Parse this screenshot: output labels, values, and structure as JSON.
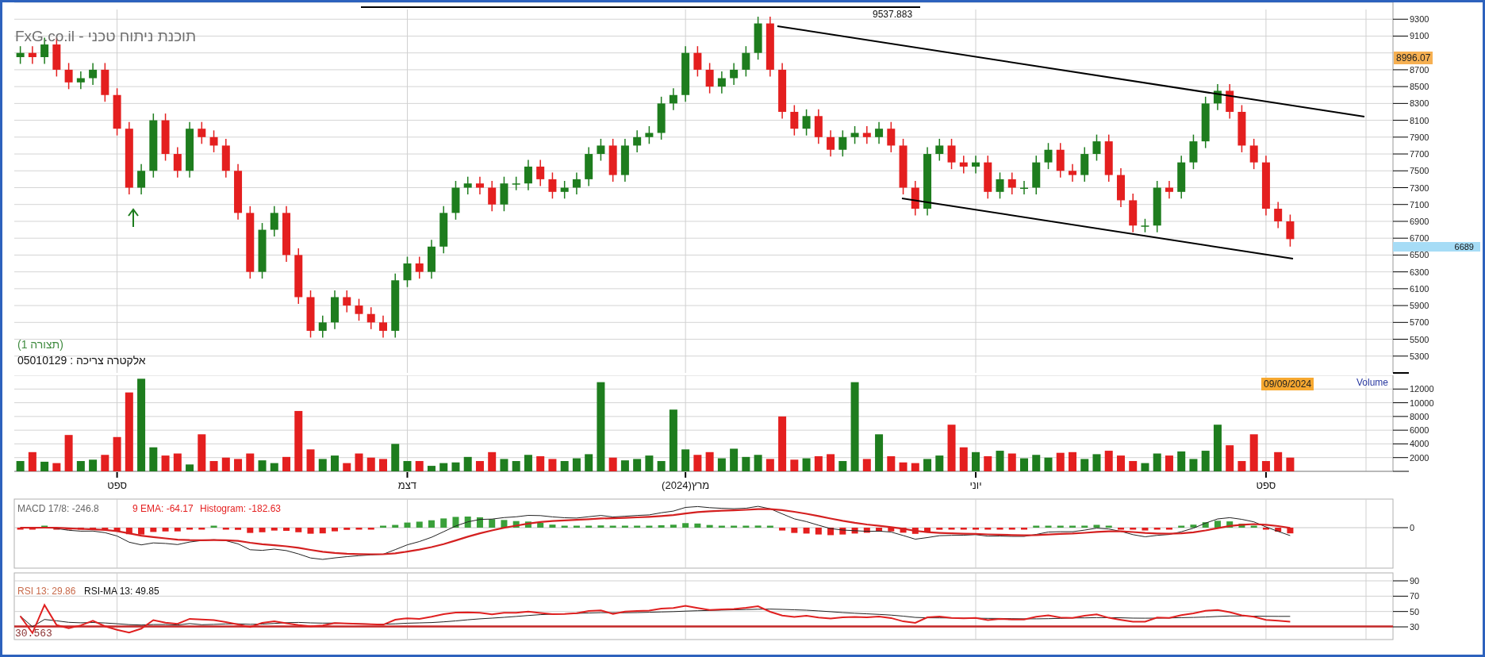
{
  "title": "FxG.co.il - תוכנת ניתוח טכני",
  "price_panel": {
    "layout_label": "(תצורה 1)",
    "instrument_label": "אלקטרה צריכה : 05010129",
    "high_label": "9537.883",
    "cursor_price": "8996.07",
    "last_price": "6689",
    "chart_data": {
      "type": "candlestick",
      "grid": true,
      "ylim": [
        5100,
        9500
      ],
      "yticks": [
        5300,
        5500,
        5700,
        5900,
        6100,
        6300,
        6500,
        6700,
        6900,
        7100,
        7300,
        7500,
        7700,
        7900,
        8100,
        8300,
        8500,
        8700,
        9100,
        9300
      ],
      "categories": [
        null,
        null,
        null,
        null,
        null,
        null,
        null,
        null,
        null,
        null,
        null,
        null,
        null,
        null,
        null,
        null,
        null,
        null,
        null,
        null,
        null,
        null,
        null,
        null,
        null,
        null,
        null,
        null,
        null,
        null,
        null,
        null,
        null,
        null,
        null,
        null,
        null,
        null,
        null,
        null,
        null,
        null,
        null,
        null,
        null,
        null,
        null,
        null,
        null,
        null,
        null,
        null,
        null,
        null,
        null,
        null,
        null,
        null,
        null,
        null,
        null,
        null,
        null,
        null,
        null,
        null,
        null,
        null,
        null,
        null,
        null,
        null,
        null,
        null,
        null,
        null,
        null,
        null,
        null,
        null,
        null,
        null,
        null,
        null,
        null,
        null,
        null,
        null,
        null,
        null,
        null,
        null,
        null,
        null,
        null,
        null,
        null,
        null,
        null,
        null,
        null,
        null,
        null,
        null,
        null,
        null,
        null,
        null,
        null,
        null,
        null,
        null,
        null,
        null
      ],
      "ohlc": [
        [
          8850,
          8980,
          8770,
          8900
        ],
        [
          8900,
          8980,
          8770,
          8850
        ],
        [
          8850,
          9080,
          8770,
          9000
        ],
        [
          9000,
          9080,
          8620,
          8700
        ],
        [
          8700,
          8780,
          8470,
          8550
        ],
        [
          8550,
          8680,
          8470,
          8600
        ],
        [
          8600,
          8780,
          8520,
          8700
        ],
        [
          8700,
          8780,
          8320,
          8400
        ],
        [
          8400,
          8480,
          7920,
          8000
        ],
        [
          8000,
          8080,
          7220,
          7300
        ],
        [
          7300,
          7580,
          7220,
          7500
        ],
        [
          7500,
          8180,
          7420,
          8100
        ],
        [
          8100,
          8180,
          7620,
          7700
        ],
        [
          7700,
          7780,
          7420,
          7500
        ],
        [
          7500,
          8080,
          7420,
          8000
        ],
        [
          8000,
          8080,
          7820,
          7900
        ],
        [
          7900,
          7980,
          7720,
          7800
        ],
        [
          7800,
          7880,
          7420,
          7500
        ],
        [
          7500,
          7580,
          6920,
          7000
        ],
        [
          7000,
          7080,
          6220,
          6300
        ],
        [
          6300,
          6880,
          6220,
          6800
        ],
        [
          6800,
          7080,
          6720,
          7000
        ],
        [
          7000,
          7080,
          6420,
          6500
        ],
        [
          6500,
          6580,
          5920,
          6000
        ],
        [
          6000,
          6080,
          5520,
          5600
        ],
        [
          5600,
          5780,
          5520,
          5700
        ],
        [
          5700,
          6080,
          5620,
          6000
        ],
        [
          6000,
          6080,
          5820,
          5900
        ],
        [
          5900,
          5980,
          5720,
          5800
        ],
        [
          5800,
          5880,
          5620,
          5700
        ],
        [
          5700,
          5780,
          5520,
          5600
        ],
        [
          5600,
          6280,
          5520,
          6200
        ],
        [
          6200,
          6480,
          6120,
          6400
        ],
        [
          6400,
          6480,
          6220,
          6300
        ],
        [
          6300,
          6680,
          6220,
          6600
        ],
        [
          6600,
          7080,
          6520,
          7000
        ],
        [
          7000,
          7380,
          6920,
          7300
        ],
        [
          7300,
          7430,
          7220,
          7350
        ],
        [
          7350,
          7430,
          7220,
          7300
        ],
        [
          7300,
          7380,
          7020,
          7100
        ],
        [
          7100,
          7430,
          7020,
          7350
        ],
        [
          7350,
          7430,
          7270,
          7350
        ],
        [
          7350,
          7630,
          7270,
          7550
        ],
        [
          7550,
          7630,
          7320,
          7400
        ],
        [
          7400,
          7480,
          7170,
          7250
        ],
        [
          7250,
          7380,
          7170,
          7300
        ],
        [
          7300,
          7480,
          7220,
          7400
        ],
        [
          7400,
          7780,
          7320,
          7700
        ],
        [
          7700,
          7880,
          7620,
          7800
        ],
        [
          7800,
          7880,
          7370,
          7450
        ],
        [
          7450,
          7880,
          7370,
          7800
        ],
        [
          7800,
          7980,
          7720,
          7900
        ],
        [
          7900,
          8030,
          7820,
          7950
        ],
        [
          7950,
          8380,
          7870,
          8300
        ],
        [
          8300,
          8480,
          8220,
          8400
        ],
        [
          8400,
          8980,
          8320,
          8900
        ],
        [
          8900,
          8980,
          8620,
          8700
        ],
        [
          8700,
          8780,
          8420,
          8500
        ],
        [
          8500,
          8680,
          8420,
          8600
        ],
        [
          8600,
          8780,
          8520,
          8700
        ],
        [
          8700,
          8980,
          8620,
          8900
        ],
        [
          8900,
          9330,
          8820,
          9250
        ],
        [
          9250,
          9330,
          8620,
          8700
        ],
        [
          8700,
          8780,
          8120,
          8200
        ],
        [
          8200,
          8280,
          7920,
          8000
        ],
        [
          8000,
          8230,
          7920,
          8150
        ],
        [
          8150,
          8230,
          7820,
          7900
        ],
        [
          7900,
          7980,
          7670,
          7750
        ],
        [
          7750,
          7980,
          7670,
          7900
        ],
        [
          7900,
          8030,
          7820,
          7950
        ],
        [
          7950,
          8030,
          7820,
          7900
        ],
        [
          7900,
          8080,
          7820,
          8000
        ],
        [
          8000,
          8080,
          7720,
          7800
        ],
        [
          7800,
          7880,
          7220,
          7300
        ],
        [
          7300,
          7380,
          6970,
          7050
        ],
        [
          7050,
          7780,
          6970,
          7700
        ],
        [
          7700,
          7880,
          7620,
          7800
        ],
        [
          7800,
          7880,
          7520,
          7600
        ],
        [
          7600,
          7680,
          7470,
          7550
        ],
        [
          7550,
          7680,
          7470,
          7600
        ],
        [
          7600,
          7680,
          7170,
          7250
        ],
        [
          7250,
          7480,
          7170,
          7400
        ],
        [
          7400,
          7480,
          7220,
          7300
        ],
        [
          7300,
          7380,
          7220,
          7300
        ],
        [
          7300,
          7680,
          7220,
          7600
        ],
        [
          7600,
          7830,
          7520,
          7750
        ],
        [
          7750,
          7830,
          7420,
          7500
        ],
        [
          7500,
          7580,
          7370,
          7450
        ],
        [
          7450,
          7780,
          7370,
          7700
        ],
        [
          7700,
          7930,
          7620,
          7850
        ],
        [
          7850,
          7930,
          7370,
          7450
        ],
        [
          7450,
          7530,
          7070,
          7150
        ],
        [
          7150,
          7230,
          6770,
          6850
        ],
        [
          6850,
          6930,
          6770,
          6850
        ],
        [
          6850,
          7380,
          6770,
          7300
        ],
        [
          7300,
          7380,
          7170,
          7250
        ],
        [
          7250,
          7680,
          7170,
          7600
        ],
        [
          7600,
          7930,
          7520,
          7850
        ],
        [
          7850,
          8380,
          7770,
          8300
        ],
        [
          8300,
          8530,
          8220,
          8450
        ],
        [
          8450,
          8530,
          8120,
          8200
        ],
        [
          8200,
          8280,
          7720,
          7800
        ],
        [
          7800,
          7880,
          7520,
          7600
        ],
        [
          7600,
          7680,
          6970,
          7050
        ],
        [
          7050,
          7130,
          6820,
          6900
        ],
        [
          6900,
          6980,
          6600,
          6689
        ],
        null,
        null,
        null,
        null,
        null,
        null,
        null,
        null
      ]
    }
  },
  "volume_panel": {
    "date_badge": "09/09/2024",
    "label": "Volume",
    "chart_data": {
      "type": "bar",
      "grid": true,
      "ylim": [
        0,
        14000
      ],
      "yticks": [
        2000,
        4000,
        6000,
        8000,
        10000,
        12000
      ],
      "categories": [
        null,
        null,
        null,
        null,
        null,
        null,
        null,
        null,
        "ספט",
        null,
        null,
        null,
        null,
        null,
        null,
        null,
        null,
        null,
        null,
        null,
        null,
        null,
        null,
        null,
        null,
        null,
        null,
        null,
        null,
        null,
        null,
        null,
        "דצמ",
        null,
        null,
        null,
        null,
        null,
        null,
        null,
        null,
        null,
        null,
        null,
        null,
        null,
        null,
        null,
        null,
        null,
        null,
        null,
        null,
        null,
        null,
        "מרץ(2024)",
        null,
        null,
        null,
        null,
        null,
        null,
        null,
        null,
        null,
        null,
        null,
        null,
        null,
        null,
        null,
        null,
        null,
        null,
        null,
        null,
        null,
        null,
        null,
        "יוני",
        null,
        null,
        null,
        null,
        null,
        null,
        null,
        null,
        null,
        null,
        null,
        null,
        null,
        null,
        null,
        null,
        null,
        null,
        null,
        null,
        null,
        null,
        null,
        "ספט",
        null,
        null,
        null,
        null,
        null,
        null,
        null,
        null,
        null,
        null
      ],
      "values": [
        1500,
        2800,
        1400,
        1200,
        5300,
        1500,
        1700,
        2400,
        5000,
        11500,
        13500,
        3500,
        2300,
        2600,
        1000,
        5400,
        1500,
        2000,
        1800,
        2600,
        1600,
        1200,
        2100,
        8800,
        3200,
        1800,
        2300,
        1200,
        2600,
        2000,
        1800,
        4000,
        1500,
        1500,
        800,
        1200,
        1300,
        2100,
        1500,
        2800,
        1800,
        1500,
        2400,
        2200,
        1800,
        1500,
        1900,
        2500,
        13000,
        2000,
        1600,
        1800,
        2300,
        1500,
        9000,
        3200,
        2400,
        2800,
        1900,
        3300,
        2100,
        2400,
        1800,
        8000,
        1700,
        1900,
        2200,
        2500,
        1500,
        13000,
        1800,
        5400,
        2200,
        1300,
        1200,
        1800,
        2300,
        6800,
        3500,
        2800,
        2200,
        3000,
        2600,
        1900,
        2400,
        2000,
        2700,
        2800,
        1800,
        2500,
        3000,
        2300,
        1500,
        1200,
        2600,
        2300,
        2900,
        1800,
        3000,
        6800,
        3800,
        1500,
        5400,
        1500,
        2800,
        2000,
        null,
        null,
        null,
        null,
        null,
        null,
        null,
        null
      ]
    }
  },
  "macd_panel": {
    "labels": [
      "MACD 17/8: -246.8",
      "9 EMA: -64.17",
      "Histogram: -182.63"
    ],
    "y_labels": [
      "0"
    ]
  },
  "rsi_panel": {
    "labels": [
      "RSI 13: 29.86",
      "RSI-MA 13: 49.85"
    ],
    "level_label": "30.563",
    "y_labels": [
      "90",
      "70",
      "50",
      "30"
    ]
  }
}
